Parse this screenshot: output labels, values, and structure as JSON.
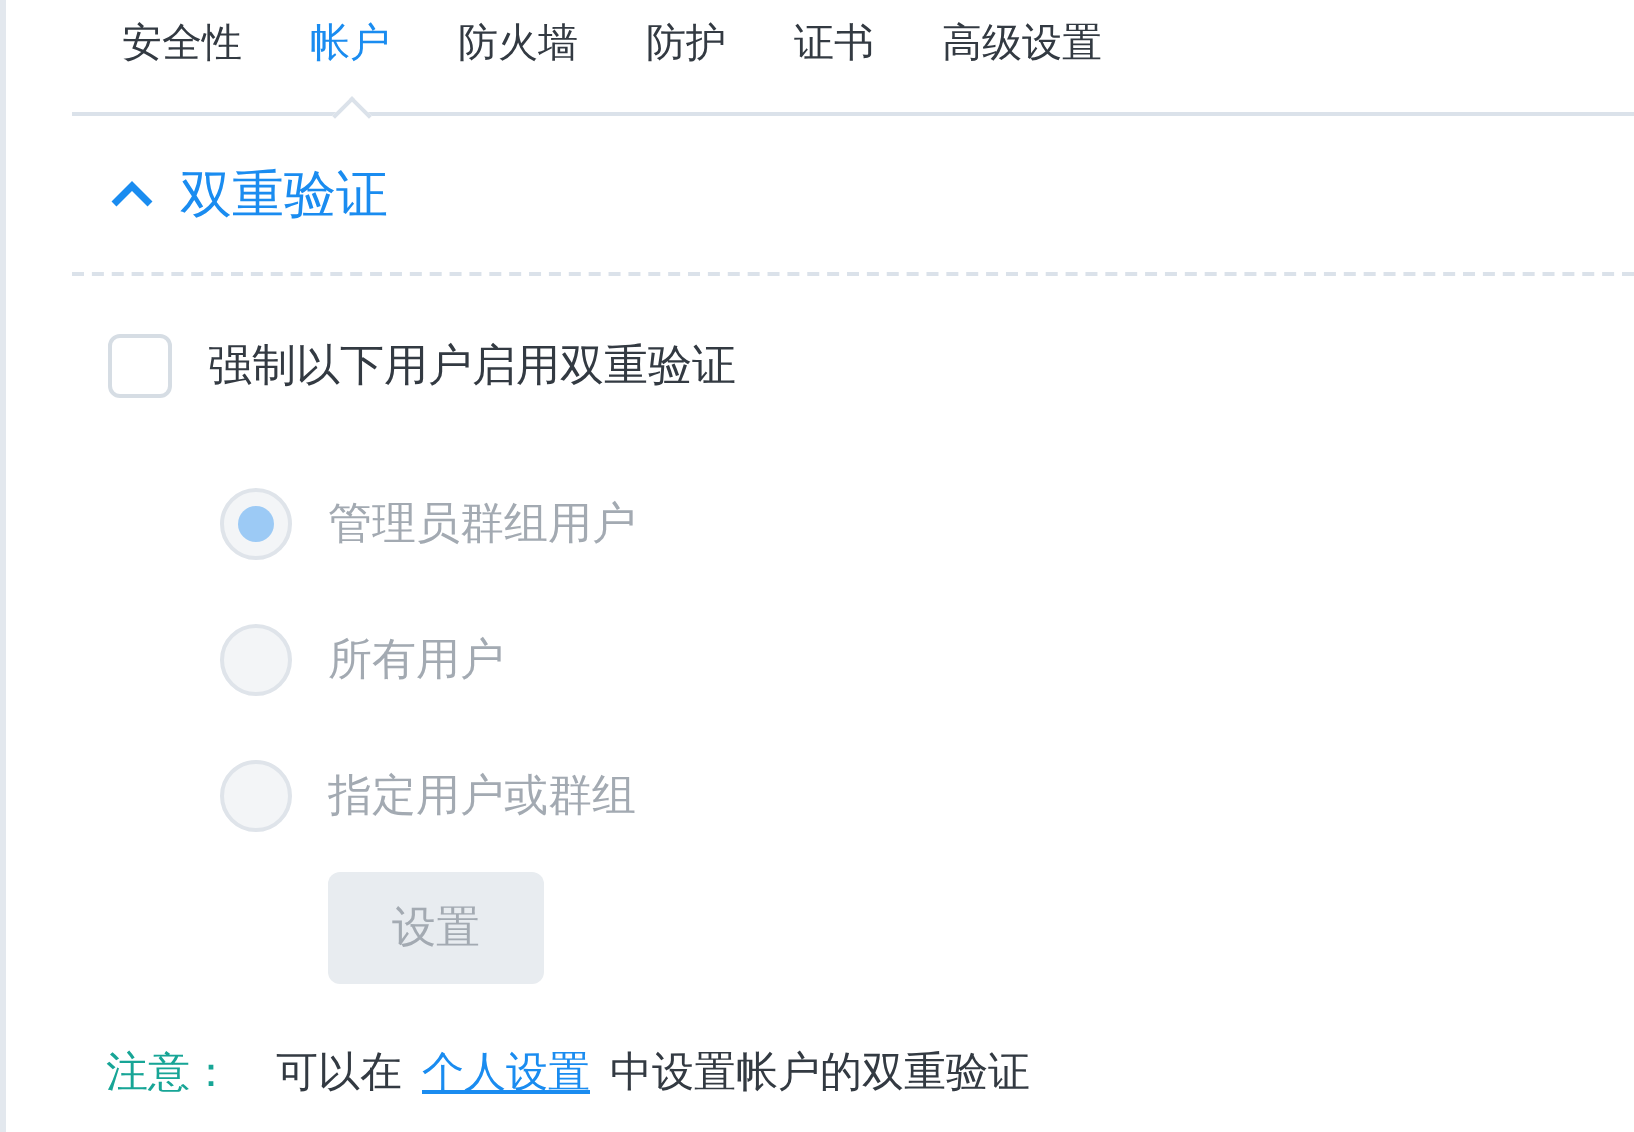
{
  "tabs": [
    {
      "label": "安全性",
      "selected": false
    },
    {
      "label": "帐户",
      "selected": true
    },
    {
      "label": "防火墙",
      "selected": false
    },
    {
      "label": "防护",
      "selected": false
    },
    {
      "label": "证书",
      "selected": false
    },
    {
      "label": "高级设置",
      "selected": false
    }
  ],
  "section": {
    "title": "双重验证",
    "expanded": true
  },
  "enforce": {
    "label": "强制以下用户启用双重验证",
    "checked": false
  },
  "options": {
    "disabled": true,
    "items": [
      {
        "label": "管理员群组用户",
        "selected": true
      },
      {
        "label": "所有用户",
        "selected": false
      },
      {
        "label": "指定用户或群组",
        "selected": false
      }
    ]
  },
  "settings_button": {
    "label": "设置",
    "disabled": true
  },
  "note": {
    "label": "注意：",
    "before": "可以在",
    "link": "个人设置",
    "after": "中设置帐户的双重验证"
  }
}
